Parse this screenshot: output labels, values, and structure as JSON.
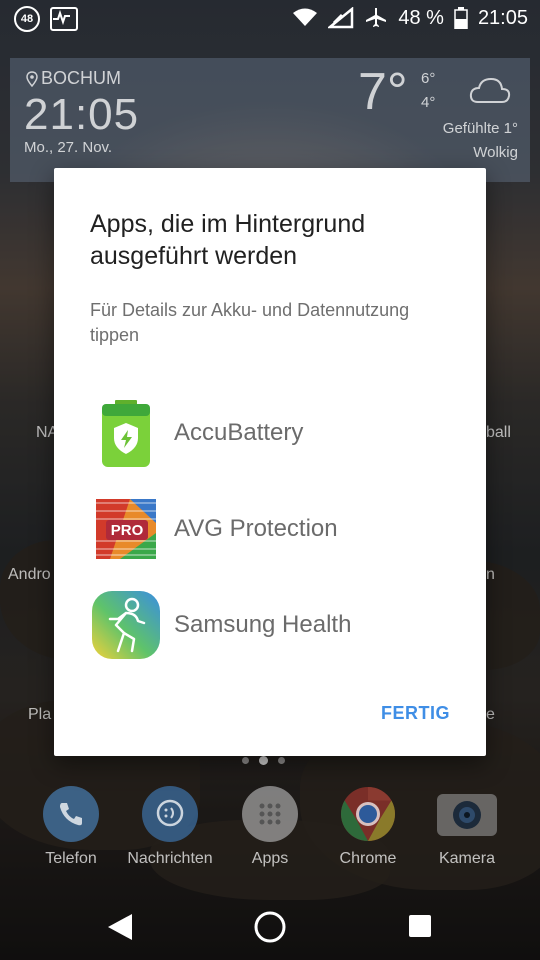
{
  "status_bar": {
    "notification_badge": "48",
    "battery_percent": "48 %",
    "time": "21:05",
    "icons": [
      "badge-48-icon",
      "pulse-icon",
      "wifi-icon",
      "signal-icon",
      "airplane-icon",
      "battery-icon"
    ]
  },
  "weather_widget": {
    "city": "BOCHUM",
    "time": "21:05",
    "date": "Mo., 27. Nov.",
    "temperature": "7°",
    "high": "6°",
    "low": "4°",
    "feels_like": "Gefühlte 1°",
    "condition": "Wolkig"
  },
  "background_labels": {
    "left_1": "NA",
    "right_1": "ball",
    "left_2": "Andro",
    "right_2": "n",
    "left_3": "Pla",
    "right_3": "e"
  },
  "dialog": {
    "title": "Apps, die im Hintergrund ausgeführt werden",
    "subtitle": "Für Details zur Akku- und Datennutzung tippen",
    "apps": [
      {
        "name": "AccuBattery",
        "icon": "accubattery-icon"
      },
      {
        "name": "AVG Protection",
        "icon": "avg-protection-icon",
        "badge": "PRO"
      },
      {
        "name": "Samsung Health",
        "icon": "samsung-health-icon"
      }
    ],
    "action_label": "FERTIG"
  },
  "dock": [
    {
      "label": "Telefon",
      "icon": "phone-icon"
    },
    {
      "label": "Nachrichten",
      "icon": "messages-icon"
    },
    {
      "label": "Apps",
      "icon": "apps-grid-icon"
    },
    {
      "label": "Chrome",
      "icon": "chrome-icon"
    },
    {
      "label": "Kamera",
      "icon": "camera-icon"
    }
  ],
  "nav_bar": [
    "back-icon",
    "home-icon",
    "recents-icon"
  ],
  "colors": {
    "accent": "#3f8ee6",
    "accubattery_green": "#7bd13a",
    "dialog_bg": "#ffffff"
  }
}
